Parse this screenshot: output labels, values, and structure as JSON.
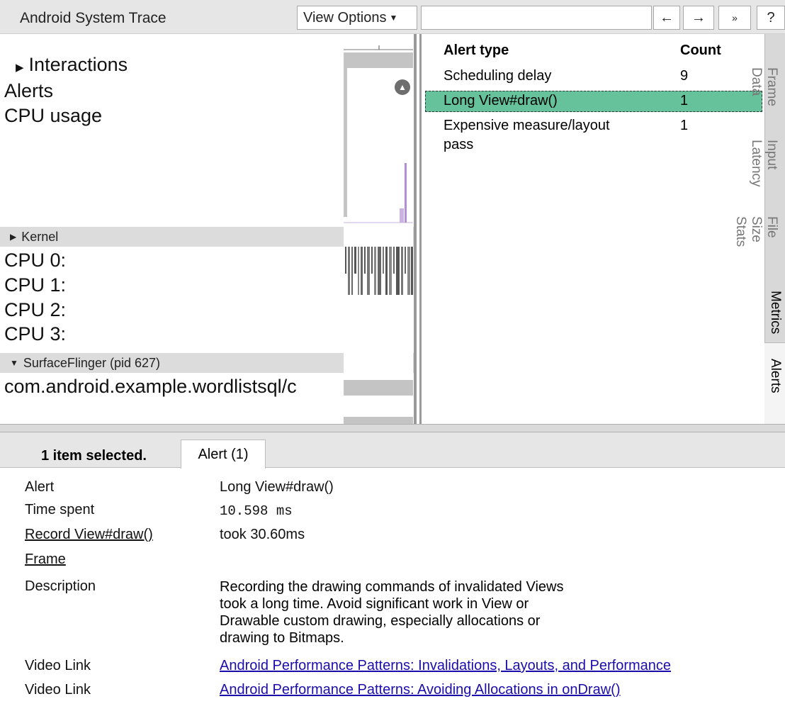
{
  "toolbar": {
    "title": "Android System Trace",
    "view_options": "View Options",
    "back": "←",
    "forward": "→",
    "more": "»",
    "help": "?"
  },
  "tracks": {
    "interactions": "Interactions",
    "alerts": "Alerts",
    "cpu_usage": "CPU usage",
    "kernel": "Kernel",
    "cpus": [
      "CPU 0:",
      "CPU 1:",
      "CPU 2:",
      "CPU 3:"
    ],
    "process_header": "SurfaceFlinger (pid 627)",
    "process_thread": "com.android.example.wordlistsql/c"
  },
  "alerts_table": {
    "headers": [
      "Alert type",
      "Count"
    ],
    "rows": [
      {
        "type": "Scheduling delay",
        "count": "9"
      },
      {
        "type": "Long View#draw()",
        "count": "1"
      },
      {
        "type": "Expensive measure/layout",
        "type2": "pass",
        "count": "1"
      }
    ],
    "selected_row": 1
  },
  "side_tabs": {
    "frame_data": "Frame\nData",
    "input_latency": "Input\nLatency",
    "file_size_stats": "File\nSize\nStats",
    "metrics": "Metrics",
    "alerts": "Alerts"
  },
  "bottom": {
    "selection": "1 item selected.",
    "tab": "Alert (1)",
    "labels": {
      "alert": "Alert",
      "time_spent": "Time spent",
      "record": "Record View#draw()",
      "frame": "Frame",
      "description": "Description",
      "video1": "Video Link",
      "video2": "Video Link"
    },
    "values": {
      "alert": "Long View#draw()",
      "time_spent": "10.598 ms",
      "record": "took 30.60ms",
      "description_lines": [
        "Recording the drawing commands of invalidated Views",
        "took a long time. Avoid significant work in View or",
        "Drawable custom drawing, especially allocations or",
        "drawing to Bitmaps."
      ],
      "video1": "Android Performance Patterns: Invalidations, Layouts, and Performance",
      "video2": "Android Performance Patterns: Avoiding Allocations in onDraw()"
    }
  },
  "colors": {
    "selected_row": "#65c29a",
    "cpu_usage_bar": "#b18fd6",
    "alert_marker": "#6e6e6e",
    "link": "#1a0dab"
  }
}
